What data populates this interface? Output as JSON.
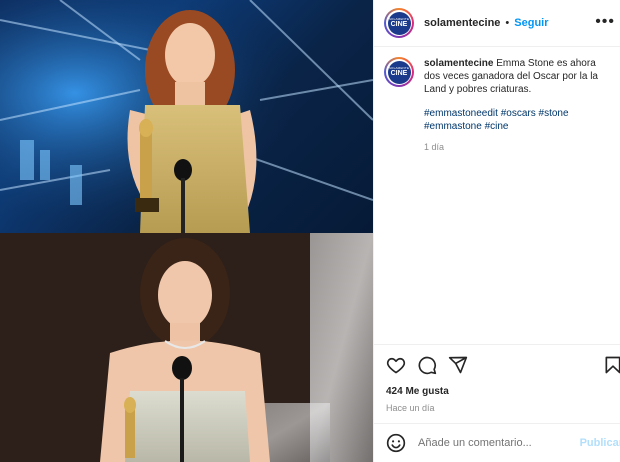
{
  "post": {
    "username": "solamentecine",
    "follow_label": "Seguir",
    "separator": "•",
    "more_label": "•••",
    "avatar": {
      "line1": "SOLAMENTE",
      "line2": "CINE"
    },
    "caption": {
      "username": "solamentecine",
      "text": "Emma Stone es ahora dos veces ganadora del Oscar por la la Land y pobres criaturas.",
      "hashtags": "#emmastoneedit #oscars #stone #emmastone #cine",
      "time_ago": "1 día"
    },
    "icons": [
      "heart-icon",
      "comment-icon",
      "share-icon",
      "bookmark-icon",
      "emoji-icon"
    ],
    "likes": "424 Me gusta",
    "date": "Hace un día",
    "comment": {
      "placeholder": "Añade un comentario...",
      "value": "",
      "publish_label": "Publicar"
    },
    "colors": {
      "link_blue": "#0095f6",
      "hashtag": "#00376b",
      "publish_disabled": "#b2dffc",
      "muted": "#8e8e8e"
    }
  }
}
